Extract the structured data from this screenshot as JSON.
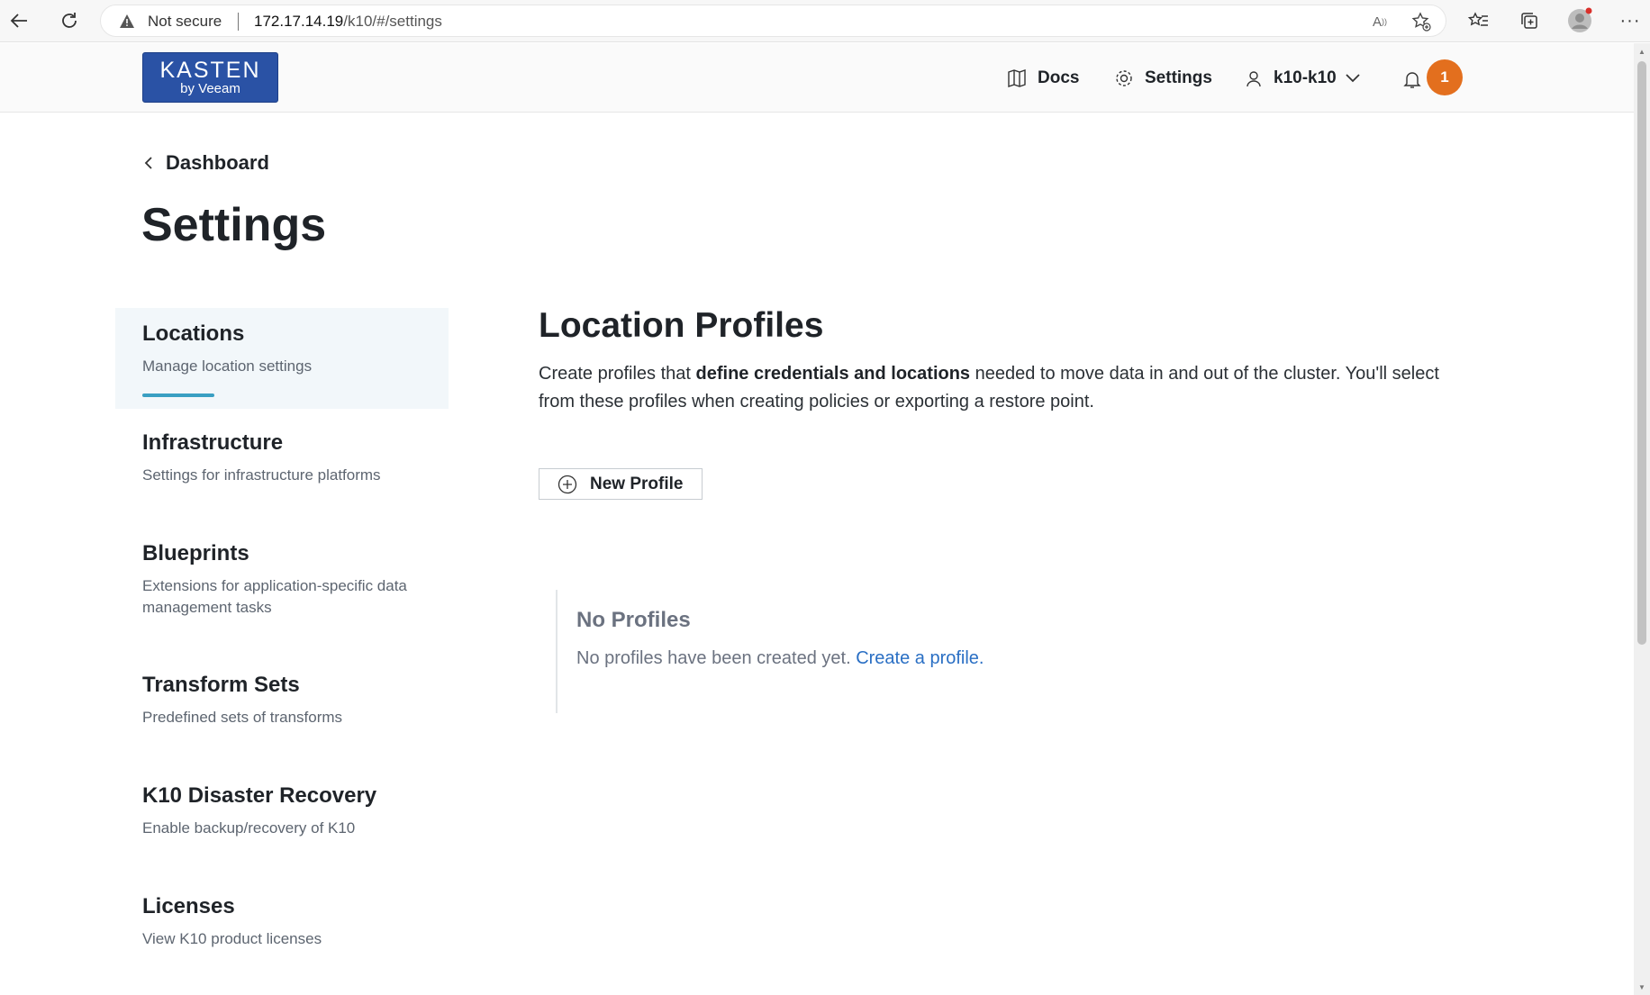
{
  "browser": {
    "security_label": "Not secure",
    "url_host": "172.17.14.19",
    "url_path": "/k10/#/settings"
  },
  "header": {
    "logo_main": "KASTEN",
    "logo_sub": "by Veeam",
    "docs_label": "Docs",
    "settings_label": "Settings",
    "user_label": "k10-k10",
    "notification_count": "1",
    "colors": {
      "logo_bg": "#2a52a5",
      "badge_bg": "#e36f1e"
    }
  },
  "page": {
    "breadcrumb": "Dashboard",
    "title": "Settings"
  },
  "sidebar": {
    "items": [
      {
        "title": "Locations",
        "desc": "Manage location settings",
        "active": true
      },
      {
        "title": "Infrastructure",
        "desc": "Settings for infrastructure platforms"
      },
      {
        "title": "Blueprints",
        "desc": "Extensions for application-specific data management tasks"
      },
      {
        "title": "Transform Sets",
        "desc": "Predefined sets of transforms"
      },
      {
        "title": "K10 Disaster Recovery",
        "desc": "Enable backup/recovery of K10"
      },
      {
        "title": "Licenses",
        "desc": "View K10 product licenses"
      }
    ],
    "active_color": "#3a9fc2"
  },
  "main": {
    "title": "Location Profiles",
    "desc_before": "Create profiles that ",
    "desc_bold": "define credentials and locations",
    "desc_after": " needed to move data in and out of the cluster. You'll select from these profiles when creating policies or exporting a restore point.",
    "new_profile_label": "New Profile",
    "empty_title": "No Profiles",
    "empty_text": "No profiles have been created yet. ",
    "empty_link": "Create a profile."
  }
}
